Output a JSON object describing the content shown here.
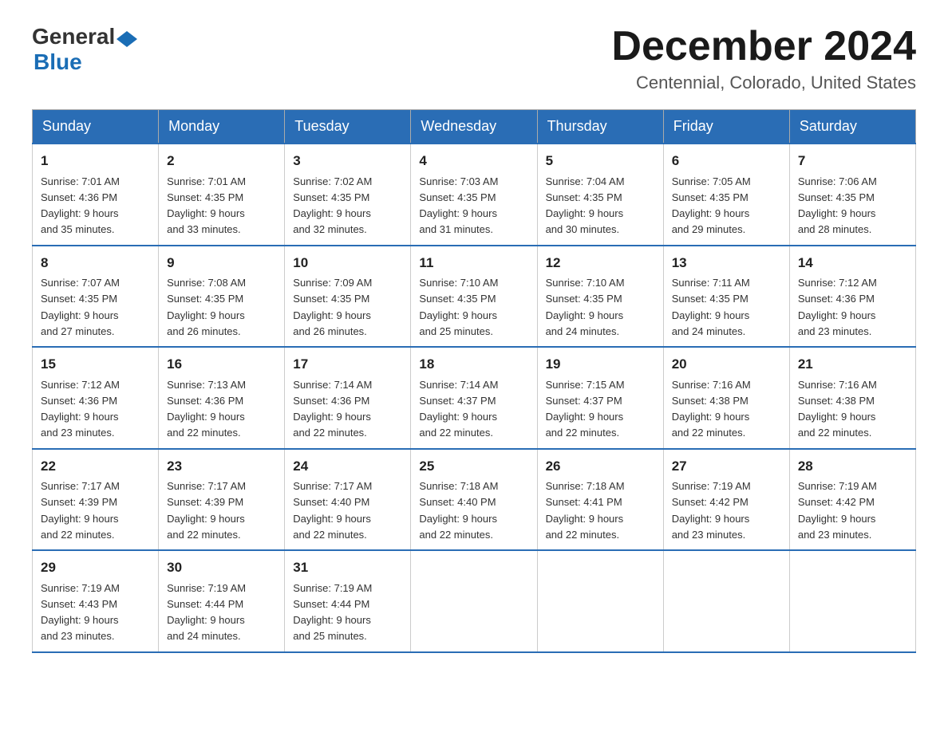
{
  "logo": {
    "general": "General",
    "blue": "Blue"
  },
  "title": {
    "month_year": "December 2024",
    "location": "Centennial, Colorado, United States"
  },
  "days_of_week": [
    "Sunday",
    "Monday",
    "Tuesday",
    "Wednesday",
    "Thursday",
    "Friday",
    "Saturday"
  ],
  "weeks": [
    [
      {
        "day": "1",
        "sunrise": "7:01 AM",
        "sunset": "4:36 PM",
        "daylight": "9 hours and 35 minutes."
      },
      {
        "day": "2",
        "sunrise": "7:01 AM",
        "sunset": "4:35 PM",
        "daylight": "9 hours and 33 minutes."
      },
      {
        "day": "3",
        "sunrise": "7:02 AM",
        "sunset": "4:35 PM",
        "daylight": "9 hours and 32 minutes."
      },
      {
        "day": "4",
        "sunrise": "7:03 AM",
        "sunset": "4:35 PM",
        "daylight": "9 hours and 31 minutes."
      },
      {
        "day": "5",
        "sunrise": "7:04 AM",
        "sunset": "4:35 PM",
        "daylight": "9 hours and 30 minutes."
      },
      {
        "day": "6",
        "sunrise": "7:05 AM",
        "sunset": "4:35 PM",
        "daylight": "9 hours and 29 minutes."
      },
      {
        "day": "7",
        "sunrise": "7:06 AM",
        "sunset": "4:35 PM",
        "daylight": "9 hours and 28 minutes."
      }
    ],
    [
      {
        "day": "8",
        "sunrise": "7:07 AM",
        "sunset": "4:35 PM",
        "daylight": "9 hours and 27 minutes."
      },
      {
        "day": "9",
        "sunrise": "7:08 AM",
        "sunset": "4:35 PM",
        "daylight": "9 hours and 26 minutes."
      },
      {
        "day": "10",
        "sunrise": "7:09 AM",
        "sunset": "4:35 PM",
        "daylight": "9 hours and 26 minutes."
      },
      {
        "day": "11",
        "sunrise": "7:10 AM",
        "sunset": "4:35 PM",
        "daylight": "9 hours and 25 minutes."
      },
      {
        "day": "12",
        "sunrise": "7:10 AM",
        "sunset": "4:35 PM",
        "daylight": "9 hours and 24 minutes."
      },
      {
        "day": "13",
        "sunrise": "7:11 AM",
        "sunset": "4:35 PM",
        "daylight": "9 hours and 24 minutes."
      },
      {
        "day": "14",
        "sunrise": "7:12 AM",
        "sunset": "4:36 PM",
        "daylight": "9 hours and 23 minutes."
      }
    ],
    [
      {
        "day": "15",
        "sunrise": "7:12 AM",
        "sunset": "4:36 PM",
        "daylight": "9 hours and 23 minutes."
      },
      {
        "day": "16",
        "sunrise": "7:13 AM",
        "sunset": "4:36 PM",
        "daylight": "9 hours and 22 minutes."
      },
      {
        "day": "17",
        "sunrise": "7:14 AM",
        "sunset": "4:36 PM",
        "daylight": "9 hours and 22 minutes."
      },
      {
        "day": "18",
        "sunrise": "7:14 AM",
        "sunset": "4:37 PM",
        "daylight": "9 hours and 22 minutes."
      },
      {
        "day": "19",
        "sunrise": "7:15 AM",
        "sunset": "4:37 PM",
        "daylight": "9 hours and 22 minutes."
      },
      {
        "day": "20",
        "sunrise": "7:16 AM",
        "sunset": "4:38 PM",
        "daylight": "9 hours and 22 minutes."
      },
      {
        "day": "21",
        "sunrise": "7:16 AM",
        "sunset": "4:38 PM",
        "daylight": "9 hours and 22 minutes."
      }
    ],
    [
      {
        "day": "22",
        "sunrise": "7:17 AM",
        "sunset": "4:39 PM",
        "daylight": "9 hours and 22 minutes."
      },
      {
        "day": "23",
        "sunrise": "7:17 AM",
        "sunset": "4:39 PM",
        "daylight": "9 hours and 22 minutes."
      },
      {
        "day": "24",
        "sunrise": "7:17 AM",
        "sunset": "4:40 PM",
        "daylight": "9 hours and 22 minutes."
      },
      {
        "day": "25",
        "sunrise": "7:18 AM",
        "sunset": "4:40 PM",
        "daylight": "9 hours and 22 minutes."
      },
      {
        "day": "26",
        "sunrise": "7:18 AM",
        "sunset": "4:41 PM",
        "daylight": "9 hours and 22 minutes."
      },
      {
        "day": "27",
        "sunrise": "7:19 AM",
        "sunset": "4:42 PM",
        "daylight": "9 hours and 23 minutes."
      },
      {
        "day": "28",
        "sunrise": "7:19 AM",
        "sunset": "4:42 PM",
        "daylight": "9 hours and 23 minutes."
      }
    ],
    [
      {
        "day": "29",
        "sunrise": "7:19 AM",
        "sunset": "4:43 PM",
        "daylight": "9 hours and 23 minutes."
      },
      {
        "day": "30",
        "sunrise": "7:19 AM",
        "sunset": "4:44 PM",
        "daylight": "9 hours and 24 minutes."
      },
      {
        "day": "31",
        "sunrise": "7:19 AM",
        "sunset": "4:44 PM",
        "daylight": "9 hours and 25 minutes."
      },
      null,
      null,
      null,
      null
    ]
  ],
  "labels": {
    "sunrise": "Sunrise:",
    "sunset": "Sunset:",
    "daylight": "Daylight:"
  }
}
